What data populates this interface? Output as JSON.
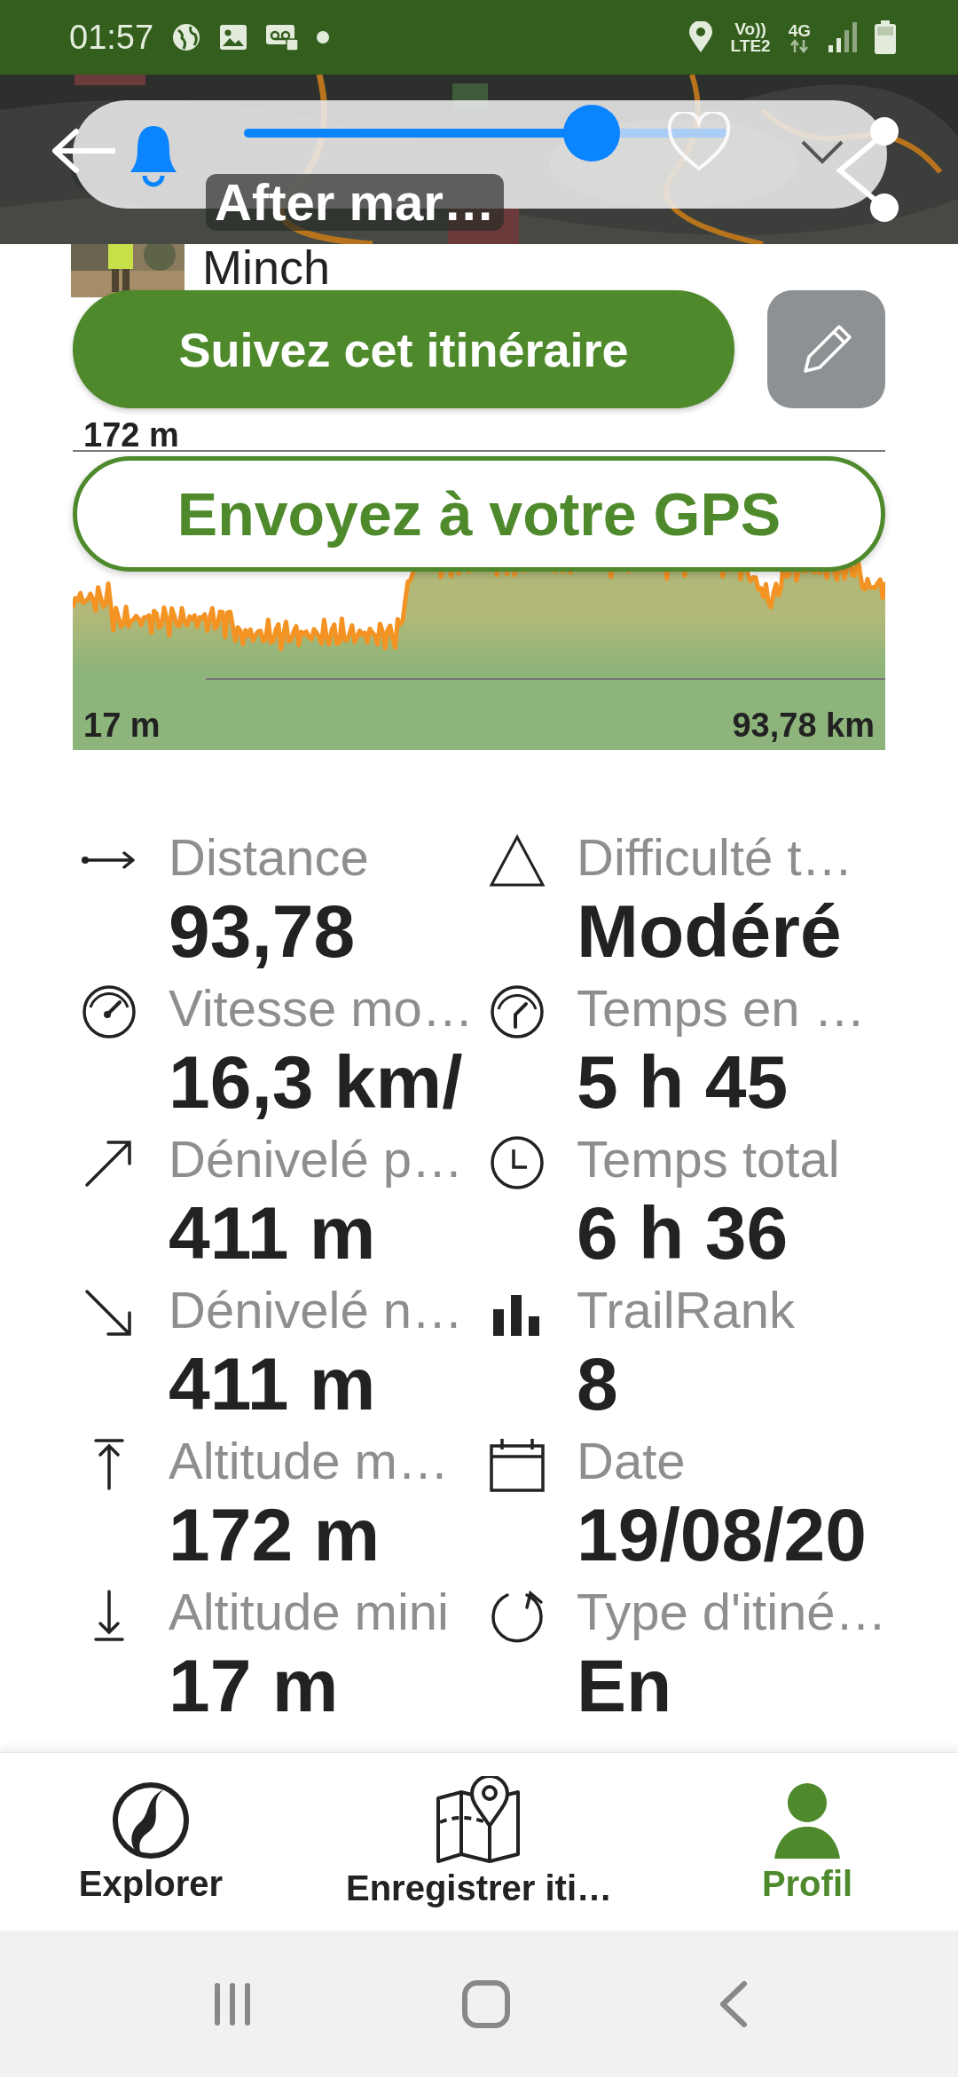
{
  "status_bar": {
    "time": "01:57",
    "volte": "Vo))",
    "lte": "LTE2",
    "network": "4G"
  },
  "header": {
    "title": "After mar…",
    "alert_slider": {
      "level": 0.72
    },
    "favorite": false
  },
  "author": {
    "name": "Minch"
  },
  "follow_button": "Suivez cet itinéraire",
  "chart": {
    "max_label": "172 m",
    "min_label": "17 m",
    "distance_label": "93,78 km"
  },
  "gps_button": "Envoyez à votre GPS",
  "stats": [
    {
      "kind": "distance",
      "label": "Distance",
      "value": "93,78"
    },
    {
      "kind": "difficulty",
      "label": "Difficulté t…",
      "value": "Modéré"
    },
    {
      "kind": "speed",
      "label": "Vitesse mo…",
      "value": "16,3 km/"
    },
    {
      "kind": "moving-time",
      "label": "Temps en …",
      "value": "5 h 45"
    },
    {
      "kind": "ascent",
      "label": "Dénivelé p…",
      "value": "411 m"
    },
    {
      "kind": "clock",
      "label": "Temps total",
      "value": "6 h 36"
    },
    {
      "kind": "descent",
      "label": "Dénivelé n…",
      "value": "411 m"
    },
    {
      "kind": "rank",
      "label": "TrailRank",
      "value": "8"
    },
    {
      "kind": "max-alt",
      "label": "Altitude m…",
      "value": "172 m"
    },
    {
      "kind": "calendar",
      "label": "Date",
      "value": "19/08/20"
    },
    {
      "kind": "min-alt",
      "label": "Altitude mini",
      "value": "17 m"
    },
    {
      "kind": "loop",
      "label": "Type d'itiné…",
      "value": "En"
    }
  ],
  "nav": [
    {
      "kind": "explorer",
      "label": "Explorer",
      "selected": false
    },
    {
      "kind": "map",
      "label": "Enregistrer iti…",
      "selected": false
    },
    {
      "kind": "profile",
      "label": "Profil",
      "selected": true
    }
  ]
}
